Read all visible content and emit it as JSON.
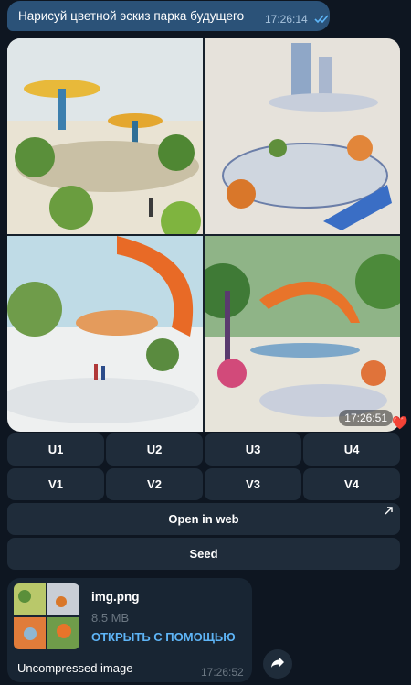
{
  "outgoing": {
    "text": "Нарисуй цветной эскиз парка будущего",
    "time": "17:26:14"
  },
  "photo": {
    "time": "17:26:51",
    "reaction": "❤️"
  },
  "keyboard": {
    "row1": [
      "U1",
      "U2",
      "U3",
      "U4"
    ],
    "row2": [
      "V1",
      "V2",
      "V3",
      "V4"
    ],
    "open_web": "Open in web",
    "seed": "Seed"
  },
  "file": {
    "name": "img.png",
    "size": "8.5 MB",
    "open_with": "ОТКРЫТЬ С ПОМОЩЬЮ",
    "caption": "Uncompressed image",
    "time": "17:26:52"
  },
  "icons": {
    "read_status": "double-check-icon",
    "external_link": "arrow-up-right-icon",
    "forward": "forward-arrow-icon"
  },
  "colors": {
    "background": "#0e1621",
    "outgoing_bubble": "#2b5278",
    "incoming_bubble": "#182533",
    "keyboard_button": "#1f2c3a",
    "link": "#5eb5f7"
  }
}
